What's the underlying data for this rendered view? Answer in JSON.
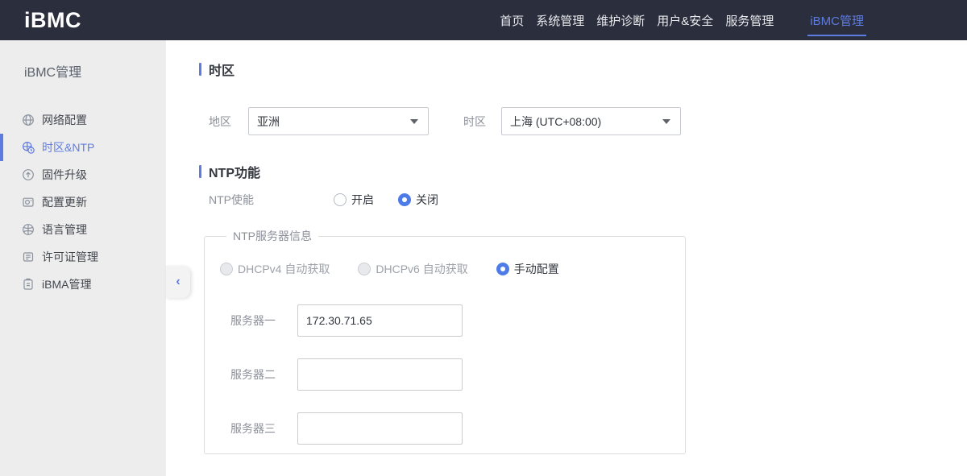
{
  "header": {
    "logo": "iBMC",
    "nav": [
      {
        "label": "首页",
        "active": false
      },
      {
        "label": "系统管理",
        "active": false
      },
      {
        "label": "维护诊断",
        "active": false
      },
      {
        "label": "用户&安全",
        "active": false
      },
      {
        "label": "服务管理",
        "active": false
      },
      {
        "label": "iBMC管理",
        "active": true
      }
    ]
  },
  "sidebar": {
    "title": "iBMC管理",
    "items": [
      {
        "label": "网络配置",
        "icon": "network-globe-icon",
        "active": false
      },
      {
        "label": "时区&NTP",
        "icon": "timezone-clock-icon",
        "active": true
      },
      {
        "label": "固件升级",
        "icon": "firmware-upgrade-icon",
        "active": false
      },
      {
        "label": "配置更新",
        "icon": "config-update-icon",
        "active": false
      },
      {
        "label": "语言管理",
        "icon": "language-icon",
        "active": false
      },
      {
        "label": "许可证管理",
        "icon": "license-icon",
        "active": false
      },
      {
        "label": "iBMA管理",
        "icon": "ibma-clipboard-icon",
        "active": false
      }
    ],
    "collapse_icon": "‹"
  },
  "main": {
    "timezone_section": {
      "title": "时区",
      "region": {
        "label": "地区",
        "value": "亚洲"
      },
      "timezone": {
        "label": "时区",
        "value": "上海 (UTC+08:00)"
      }
    },
    "ntp_section": {
      "title": "NTP功能",
      "enable": {
        "label": "NTP使能",
        "options": [
          {
            "label": "开启",
            "selected": false
          },
          {
            "label": "关闭",
            "selected": true
          }
        ]
      },
      "server_group": {
        "legend": "NTP服务器信息",
        "modes": [
          {
            "label": "DHCPv4 自动获取",
            "selected": false,
            "disabled": true
          },
          {
            "label": "DHCPv6 自动获取",
            "selected": false,
            "disabled": true
          },
          {
            "label": "手动配置",
            "selected": true,
            "disabled": false
          }
        ],
        "servers": [
          {
            "label": "服务器一",
            "value": "172.30.71.65"
          },
          {
            "label": "服务器二",
            "value": ""
          },
          {
            "label": "服务器三",
            "value": ""
          }
        ]
      }
    }
  },
  "colors": {
    "accent": "#5e7ce0",
    "radio_selected": "#4d7ce8",
    "header_bg": "#2b2e3c",
    "sidebar_bg": "#ededed"
  }
}
